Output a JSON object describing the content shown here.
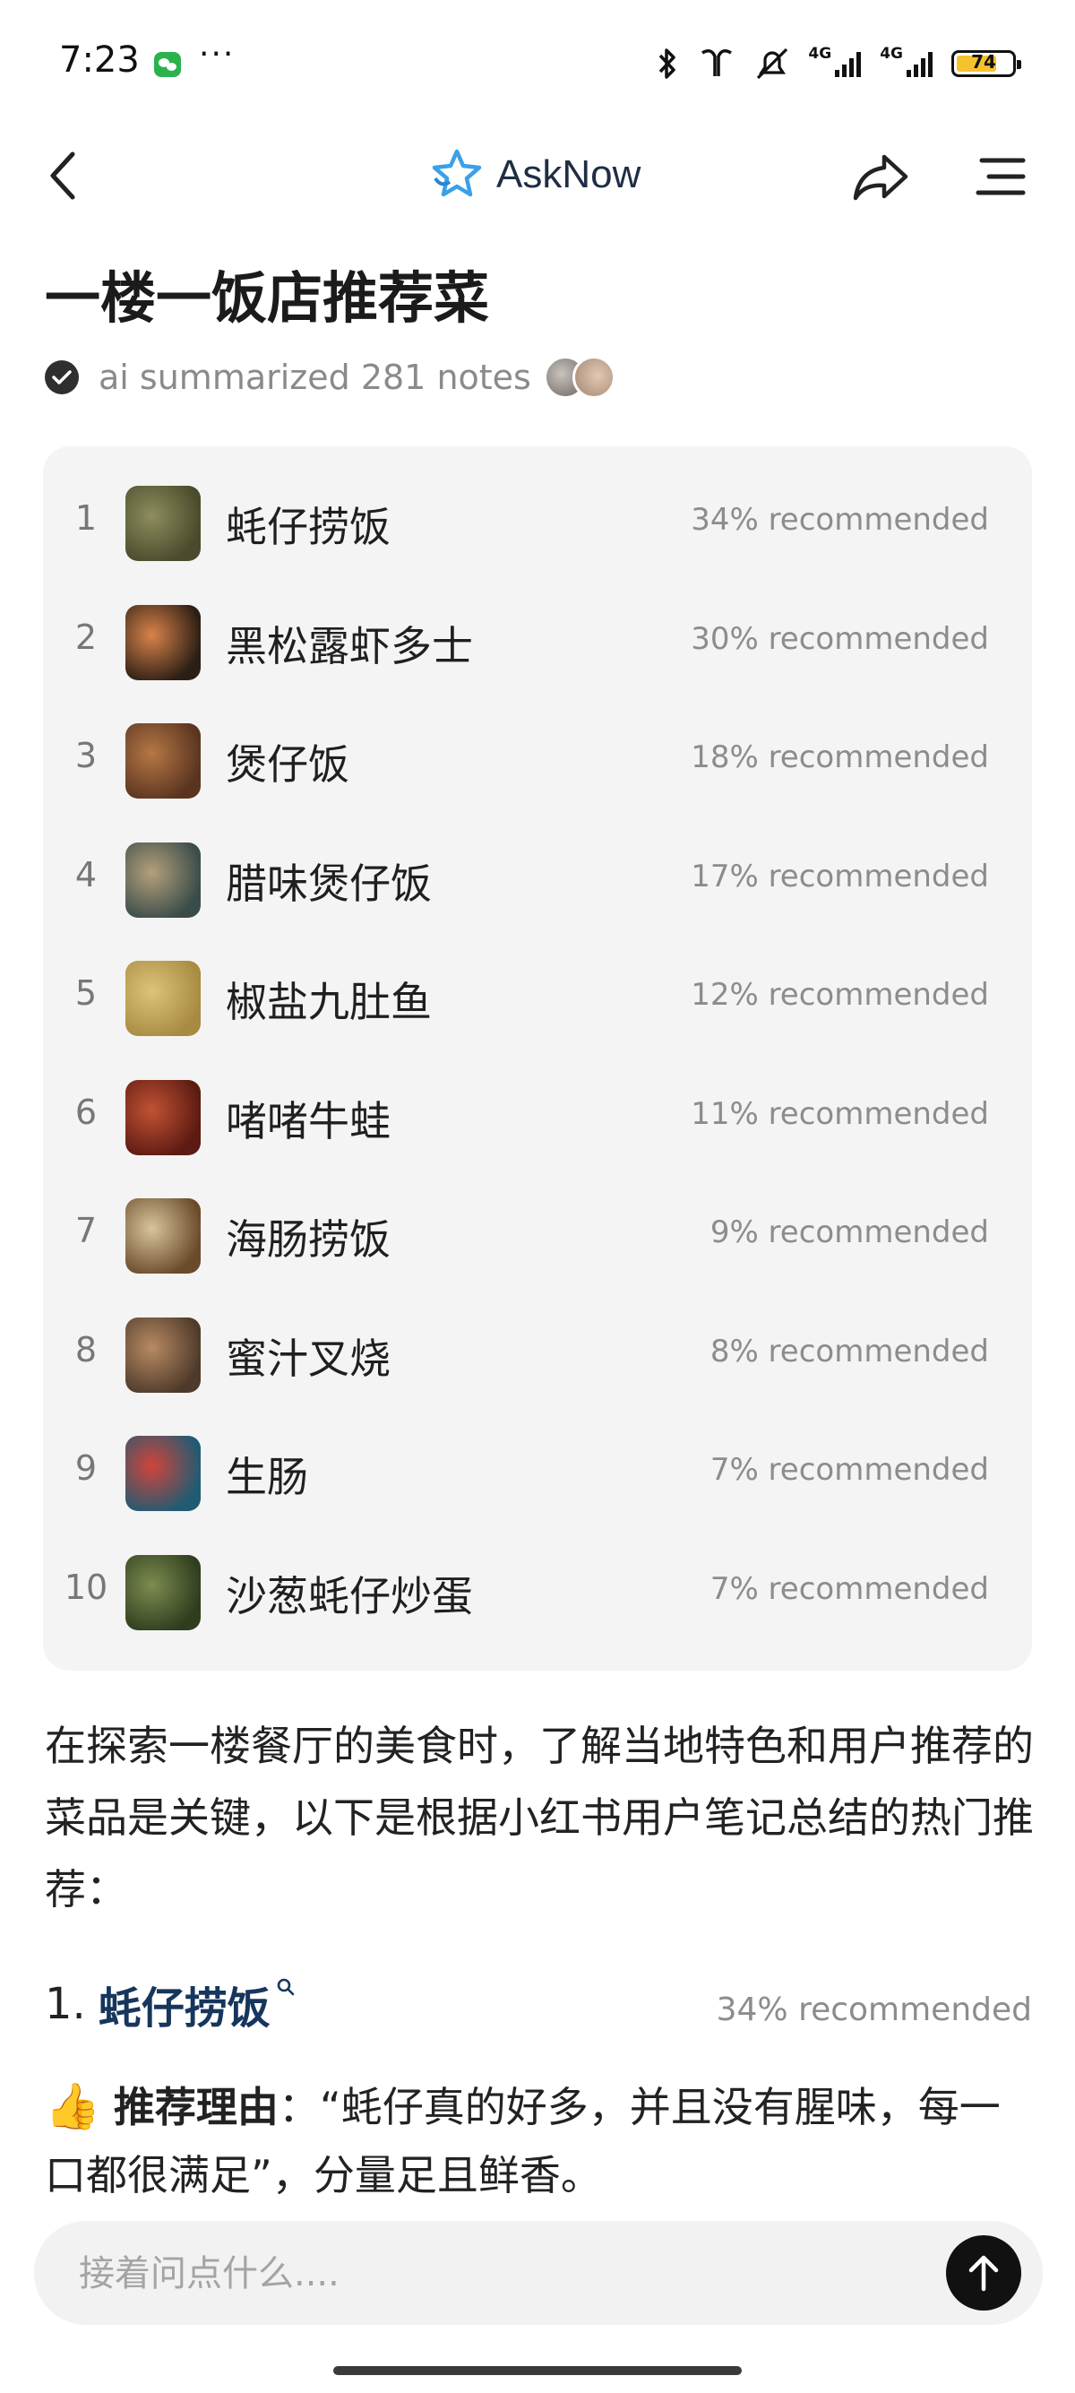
{
  "status_bar": {
    "time": "7:23",
    "more": "···",
    "battery": "74",
    "battery_fraction": 0.74,
    "net_1": "4G",
    "net_2": "4G",
    "icons": [
      "wechat-icon",
      "bluetooth-icon",
      "earbuds-icon",
      "mute-icon",
      "signal-icon",
      "signal-icon",
      "battery-icon"
    ]
  },
  "nav": {
    "brand": "AskNow",
    "icons": [
      "back-icon",
      "asknow-logo-icon",
      "share-icon",
      "menu-icon"
    ]
  },
  "page": {
    "title": "一楼一饭店推荐菜",
    "summary": "ai summarized 281 notes"
  },
  "ranking": [
    {
      "rank": "1",
      "name": "蚝仔捞饭",
      "percent": "34% recommended",
      "thumb_colors": [
        "#4a4a2c",
        "#8d8d5e"
      ]
    },
    {
      "rank": "2",
      "name": "黑松露虾多士",
      "percent": "30% recommended",
      "thumb_colors": [
        "#2b1e14",
        "#d9834a"
      ]
    },
    {
      "rank": "3",
      "name": "煲仔饭",
      "percent": "18% recommended",
      "thumb_colors": [
        "#5a3420",
        "#b57845"
      ]
    },
    {
      "rank": "4",
      "name": "腊味煲仔饭",
      "percent": "17% recommended",
      "thumb_colors": [
        "#3a4c4a",
        "#b4a07a"
      ]
    },
    {
      "rank": "5",
      "name": "椒盐九肚鱼",
      "percent": "12% recommended",
      "thumb_colors": [
        "#a88b42",
        "#dcc27a"
      ]
    },
    {
      "rank": "6",
      "name": "啫啫牛蛙",
      "percent": "11% recommended",
      "thumb_colors": [
        "#5b1a12",
        "#c25234"
      ]
    },
    {
      "rank": "7",
      "name": "海肠捞饭",
      "percent": "9% recommended",
      "thumb_colors": [
        "#6a4a2a",
        "#d7c59b"
      ]
    },
    {
      "rank": "8",
      "name": "蜜汁叉烧",
      "percent": "8% recommended",
      "thumb_colors": [
        "#4e3a2a",
        "#b88a63"
      ]
    },
    {
      "rank": "9",
      "name": "生肠",
      "percent": "7% recommended",
      "thumb_colors": [
        "#1f5b73",
        "#d0443a"
      ]
    },
    {
      "rank": "10",
      "name": "沙葱蚝仔炒蛋",
      "percent": "7% recommended",
      "thumb_colors": [
        "#2e3d1d",
        "#7d8c4f"
      ]
    }
  ],
  "content": {
    "intro": "在探索一楼餐厅的美食时，了解当地特色和用户推荐的菜品是关键，以下是根据小红书用户笔记总结的热门推荐：",
    "section_number": "1.",
    "section_dish": "蚝仔捞饭",
    "section_percent": "34% recommended",
    "reason_emoji": "👍",
    "reason_label": "推荐理由",
    "reason_text": "：“蚝仔真的好多，并且没有腥味，每一口都很满足”，分量足且鲜香。"
  },
  "input": {
    "placeholder": "接着问点什么...."
  },
  "colors": {
    "accent": "#17365d",
    "logo": "#3aa0e8",
    "card_bg": "#f4f4f4",
    "muted": "#8c8c8c"
  }
}
